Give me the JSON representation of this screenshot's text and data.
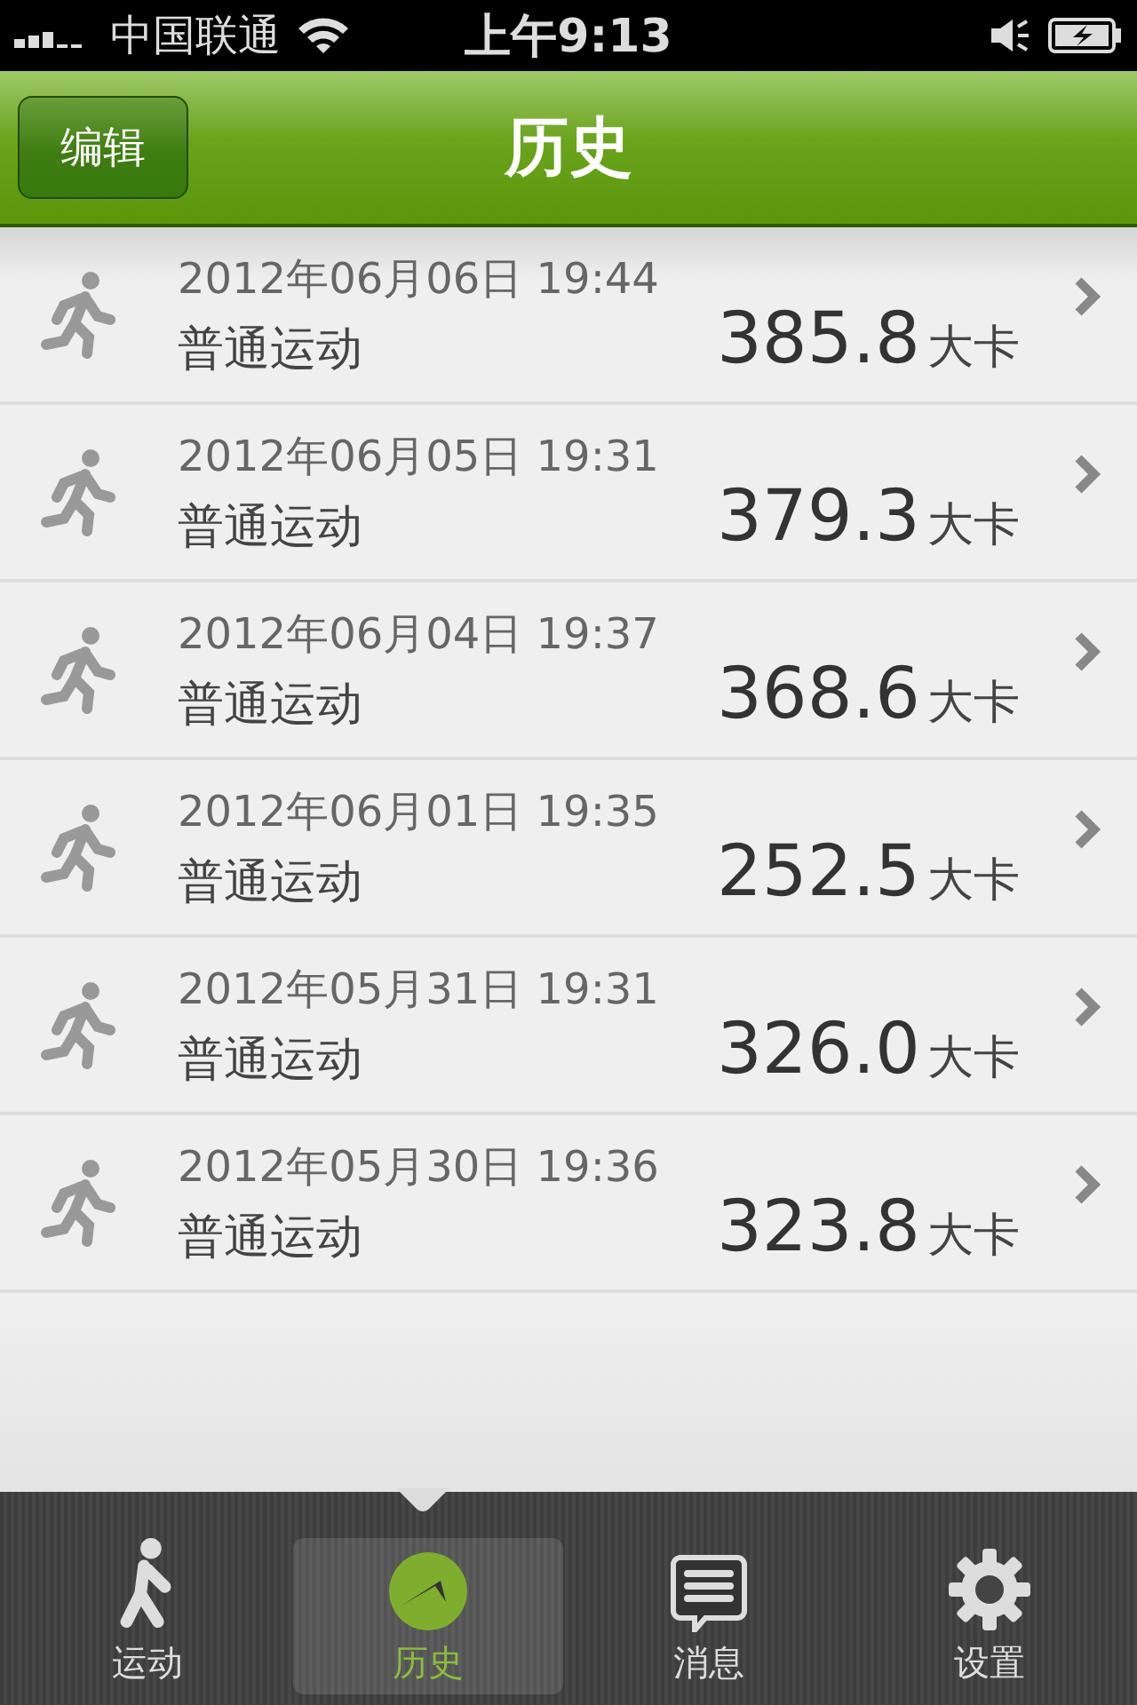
{
  "status_bar": {
    "carrier": "中国联通",
    "time": "上午9:13"
  },
  "nav": {
    "title": "历史",
    "edit_button": "编辑"
  },
  "records": [
    {
      "datetime": "2012年06月06日 19:44",
      "type": "普通运动",
      "value": "385.8",
      "unit": "大卡"
    },
    {
      "datetime": "2012年06月05日 19:31",
      "type": "普通运动",
      "value": "379.3",
      "unit": "大卡"
    },
    {
      "datetime": "2012年06月04日 19:37",
      "type": "普通运动",
      "value": "368.6",
      "unit": "大卡"
    },
    {
      "datetime": "2012年06月01日 19:35",
      "type": "普通运动",
      "value": "252.5",
      "unit": "大卡"
    },
    {
      "datetime": "2012年05月31日 19:31",
      "type": "普通运动",
      "value": "326.0",
      "unit": "大卡"
    },
    {
      "datetime": "2012年05月30日 19:36",
      "type": "普通运动",
      "value": "323.8",
      "unit": "大卡"
    }
  ],
  "tabs": [
    {
      "kind": "walk",
      "label": "运动",
      "selected": false
    },
    {
      "kind": "clock",
      "label": "历史",
      "selected": true
    },
    {
      "kind": "message",
      "label": "消息",
      "selected": false
    },
    {
      "kind": "gear",
      "label": "设置",
      "selected": false
    }
  ]
}
